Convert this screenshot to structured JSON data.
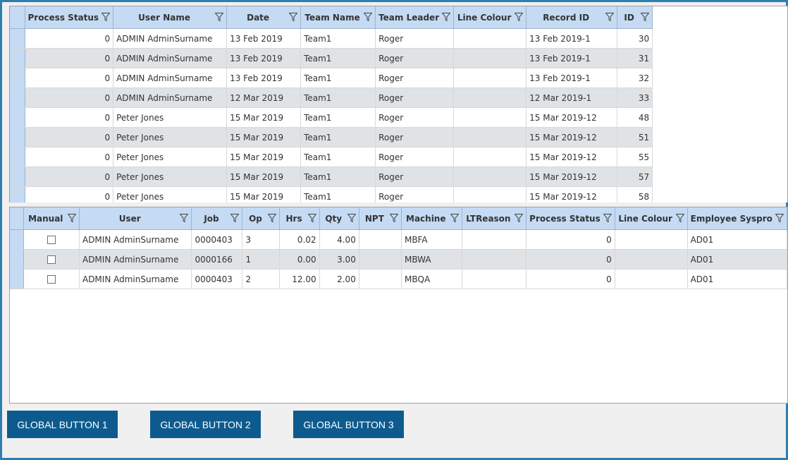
{
  "top_grid": {
    "columns": [
      "Process Status",
      "User Name",
      "Date",
      "Team Name",
      "Team Leader",
      "Line Colour",
      "Record ID",
      "ID"
    ],
    "rows": [
      [
        "0",
        "ADMIN AdminSurname",
        "13 Feb 2019",
        "Team1",
        "Roger",
        "",
        "13 Feb 2019-1",
        "30"
      ],
      [
        "0",
        "ADMIN AdminSurname",
        "13 Feb 2019",
        "Team1",
        "Roger",
        "",
        "13 Feb 2019-1",
        "31"
      ],
      [
        "0",
        "ADMIN AdminSurname",
        "13 Feb 2019",
        "Team1",
        "Roger",
        "",
        "13 Feb 2019-1",
        "32"
      ],
      [
        "0",
        "ADMIN AdminSurname",
        "12 Mar 2019",
        "Team1",
        "Roger",
        "",
        "12 Mar 2019-1",
        "33"
      ],
      [
        "0",
        "Peter Jones",
        "15 Mar 2019",
        "Team1",
        "Roger",
        "",
        "15 Mar 2019-12",
        "48"
      ],
      [
        "0",
        "Peter Jones",
        "15 Mar 2019",
        "Team1",
        "Roger",
        "",
        "15 Mar 2019-12",
        "51"
      ],
      [
        "0",
        "Peter Jones",
        "15 Mar 2019",
        "Team1",
        "Roger",
        "",
        "15 Mar 2019-12",
        "55"
      ],
      [
        "0",
        "Peter Jones",
        "15 Mar 2019",
        "Team1",
        "Roger",
        "",
        "15 Mar 2019-12",
        "57"
      ],
      [
        "0",
        "Peter Jones",
        "15 Mar 2019",
        "Team1",
        "Roger",
        "",
        "15 Mar 2019-12",
        "58"
      ]
    ]
  },
  "bottom_grid": {
    "columns": [
      "Manual",
      "User",
      "Job",
      "Op",
      "Hrs",
      "Qty",
      "NPT",
      "Machine",
      "LTReason",
      "Process Status",
      "Line Colour",
      "Employee Syspro"
    ],
    "rows": [
      [
        false,
        "ADMIN AdminSurname",
        "0000403",
        "3",
        "0.02",
        "4.00",
        "",
        "MBFA",
        "",
        "0",
        "",
        "AD01"
      ],
      [
        false,
        "ADMIN AdminSurname",
        "0000166",
        "1",
        "0.00",
        "3.00",
        "",
        "MBWA",
        "",
        "0",
        "",
        "AD01"
      ],
      [
        false,
        "ADMIN AdminSurname",
        "0000403",
        "2",
        "12.00",
        "2.00",
        "",
        "MBQA",
        "",
        "0",
        "",
        "AD01"
      ]
    ]
  },
  "buttons": {
    "b1": "GLOBAL BUTTON 1",
    "b2": "GLOBAL BUTTON 2",
    "b3": "GLOBAL BUTTON 3"
  },
  "icons": {
    "filter": "filter-icon",
    "checkbox": "checkbox-icon"
  },
  "colors": {
    "header": "#c5daf3",
    "alt_row": "#dfe3e6",
    "button": "#0d5b8e",
    "frame": "#2e7eb0"
  }
}
